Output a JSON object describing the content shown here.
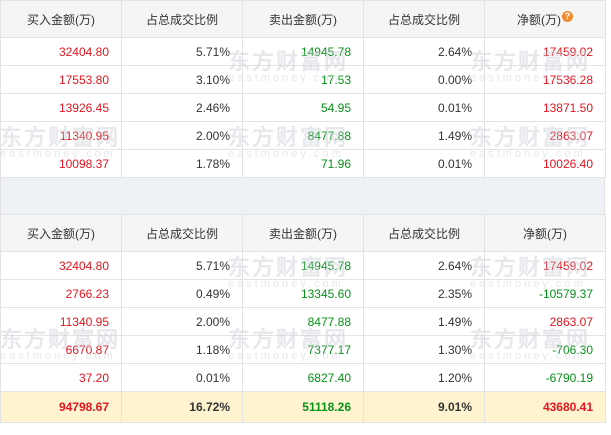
{
  "table1": {
    "headers": [
      "买入金额(万)",
      "占总成交比例",
      "卖出金额(万)",
      "占总成交比例",
      "净额(万)"
    ],
    "help_glyph": "?",
    "rows": [
      [
        "32404.80",
        "5.71%",
        "14945.78",
        "2.64%",
        "17459.02"
      ],
      [
        "17553.80",
        "3.10%",
        "17.53",
        "0.00%",
        "17536.28"
      ],
      [
        "13926.45",
        "2.46%",
        "54.95",
        "0.01%",
        "13871.50"
      ],
      [
        "11340.95",
        "2.00%",
        "8477.88",
        "1.49%",
        "2863.07"
      ],
      [
        "10098.37",
        "1.78%",
        "71.96",
        "0.01%",
        "10026.40"
      ]
    ]
  },
  "table2": {
    "headers": [
      "买入金额(万)",
      "占总成交比例",
      "卖出金额(万)",
      "占总成交比例",
      "净额(万)"
    ],
    "rows": [
      [
        "32404.80",
        "5.71%",
        "14945.78",
        "2.64%",
        "17459.02"
      ],
      [
        "2766.23",
        "0.49%",
        "13345.60",
        "2.35%",
        "-10579.37"
      ],
      [
        "11340.95",
        "2.00%",
        "8477.88",
        "1.49%",
        "2863.07"
      ],
      [
        "6670.87",
        "1.18%",
        "7377.17",
        "1.30%",
        "-706.30"
      ],
      [
        "37.20",
        "0.01%",
        "6827.40",
        "1.20%",
        "-6790.19"
      ]
    ],
    "total": [
      "94798.67",
      "16.72%",
      "51118.26",
      "9.01%",
      "43680.41"
    ]
  },
  "watermark": {
    "text": "东方财富网",
    "sub": "eastmoney.com"
  },
  "colors": {
    "buy": "#e4151e",
    "sell": "#079219",
    "total_bg": "#fff4cf",
    "gap_bg": "#eef2f7"
  }
}
